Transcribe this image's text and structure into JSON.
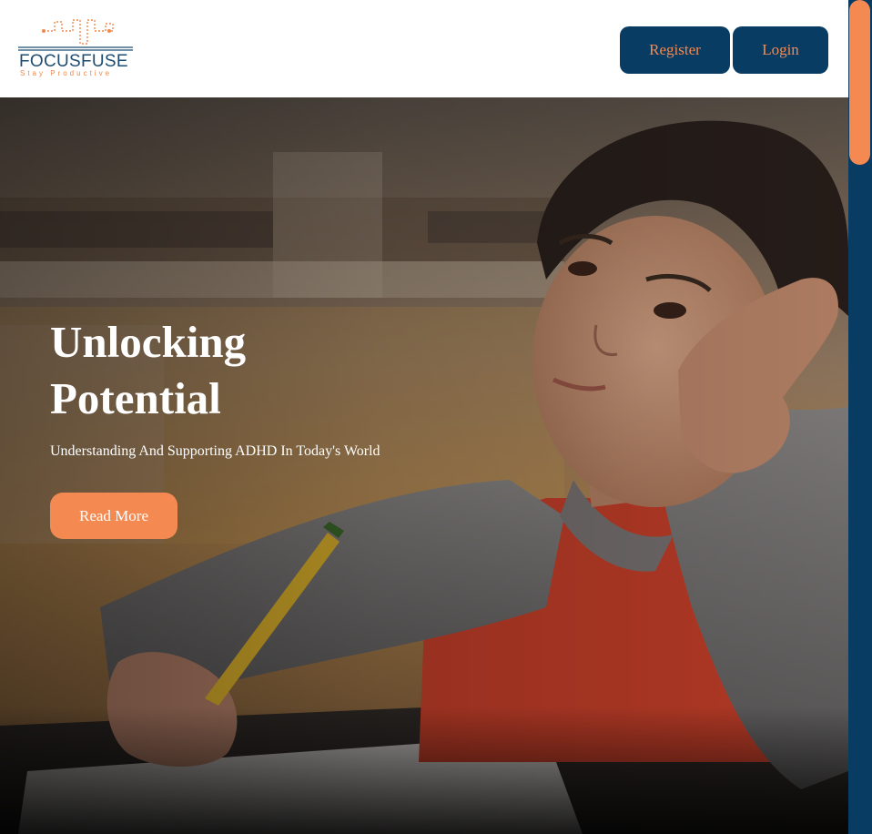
{
  "header": {
    "logo": {
      "name": "FOCUSFUSE",
      "tagline": "Stay Productive"
    },
    "register_label": "Register",
    "login_label": "Login"
  },
  "hero": {
    "title": "Unlocking Potential",
    "subtitle": "Understanding And Supporting ADHD In Today's World",
    "cta_label": "Read More"
  },
  "colors": {
    "navy": "#083c62",
    "accent_orange": "#f48a52",
    "logo_blue": "#1f4d72"
  }
}
